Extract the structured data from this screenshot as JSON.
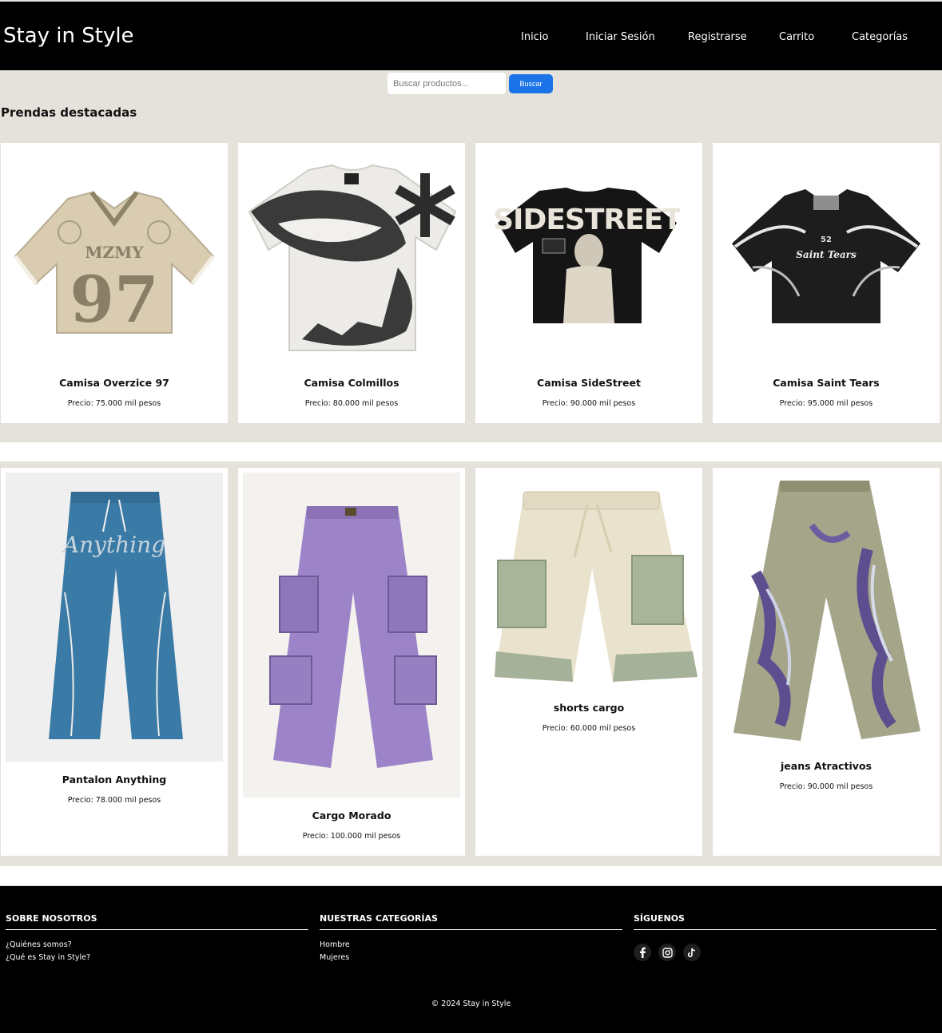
{
  "header": {
    "brand": "Stay in Style",
    "nav": [
      "Inicio",
      "Iniciar Sesión",
      "Registrarse",
      "Carrito",
      "Categorías"
    ]
  },
  "search": {
    "placeholder": "Buscar productos...",
    "button_label": "Buscar",
    "button_color": "#1a73e8"
  },
  "section": {
    "title": "Prendas destacadas"
  },
  "products": [
    {
      "name": "Camisa Overzice 97",
      "price": "Precio: 75.000 mil pesos"
    },
    {
      "name": "Camisa Colmillos",
      "price": "Precio: 80.000 mil pesos"
    },
    {
      "name": "Camisa SideStreet",
      "price": "Precio: 90.000 mil pesos"
    },
    {
      "name": "Camisa Saint Tears",
      "price": "Precio: 95.000 mil pesos"
    },
    {
      "name": "Pantalon Anything",
      "price": "Precio: 78.000 mil pesos"
    },
    {
      "name": "Cargo Morado",
      "price": "Precio: 100.000 mil pesos"
    },
    {
      "name": "shorts cargo",
      "price": "Precio: 60.000 mil pesos"
    },
    {
      "name": "jeans Atractivos",
      "price": "Precio: 90.000 mil pesos"
    }
  ],
  "footer": {
    "about": {
      "heading": "SOBRE NOSOTROS",
      "links": [
        "¿Quiénes somos?",
        "¿Qué es Stay in Style?"
      ]
    },
    "categories": {
      "heading": "NUESTRAS CATEGORÍAS",
      "links": [
        "Hombre",
        "Mujeres"
      ]
    },
    "follow": {
      "heading": "SÍGUENOS",
      "icons": [
        "facebook-icon",
        "instagram-icon",
        "tiktok-icon"
      ]
    },
    "copyright": "© 2024 Stay in Style"
  }
}
